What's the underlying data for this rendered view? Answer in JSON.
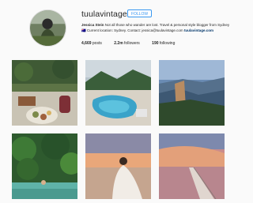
{
  "profile": {
    "username": "tuulavintage",
    "follow_label": "FOLLOW",
    "bio": {
      "name": "Jessica Stein",
      "text": "Not all those who wander are lost. Travel & personal style blogger from Sydney 🇦🇺 Current location: Sydney. Contact:",
      "email": "jessica@tuulavintage.com",
      "link": "tuulavintage.com"
    },
    "stats": {
      "posts_value": "4,669",
      "posts_label": "posts",
      "followers_value": "2.2m",
      "followers_label": "followers",
      "following_value": "190",
      "following_label": "following"
    }
  },
  "posts": [
    {
      "name": "post-garden-breakfast"
    },
    {
      "name": "post-pool-mountains"
    },
    {
      "name": "post-blue-mountains"
    },
    {
      "name": "post-jungle-pool"
    },
    {
      "name": "post-sunset-beach-dress"
    },
    {
      "name": "post-sunset-jetty"
    }
  ]
}
